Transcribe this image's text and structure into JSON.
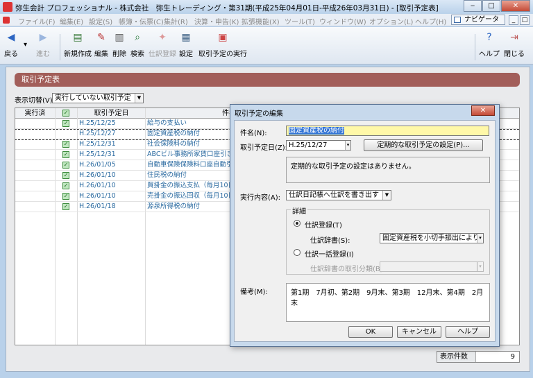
{
  "window": {
    "title": "弥生会計 プロフェッショナル - 株式会社　弥生トレーディング・第31期(平成25年04月01日-平成26年03月31日) - [取引予定表]"
  },
  "menu": [
    "ファイル(F)",
    "編集(E)",
    "設定(S)",
    "帳簿・伝票(C)",
    "集計(R)",
    "決算・申告(K)",
    "拡張機能(X)",
    "ツール(T)",
    "ウィンドウ(W)",
    "オプション(L)",
    "ヘルプ(H)"
  ],
  "navigator": "ナビゲータ",
  "toolbar": {
    "back": "戻る",
    "forward": "進む",
    "new": "新規作成",
    "edit": "編集",
    "delete": "削除",
    "search": "検索",
    "register": "仕訳登録",
    "settings": "設定",
    "execute": "取引予定の実行",
    "help": "ヘルプ",
    "close": "閉じる"
  },
  "panel": {
    "header": "取引予定表",
    "switch_label": "表示切替(V):",
    "switch_value": "実行していない取引予定",
    "columns": {
      "executed": "実行済",
      "date": "取引予定日",
      "name": "件名"
    },
    "rows": [
      {
        "checked": true,
        "date": "H.25/12/25",
        "name": "給与の支払い"
      },
      {
        "checked": false,
        "date": "H.25/12/27",
        "name": "固定資産税の納付"
      },
      {
        "checked": true,
        "date": "H.25/12/31",
        "name": "社会保険料の納付"
      },
      {
        "checked": true,
        "date": "H.25/12/31",
        "name": "ABCビル事務所家賃口座引き落"
      },
      {
        "checked": true,
        "date": "H.26/01/05",
        "name": "自動車保険保険料口座自動引"
      },
      {
        "checked": true,
        "date": "H.26/01/10",
        "name": "住民税の納付"
      },
      {
        "checked": true,
        "date": "H.26/01/10",
        "name": "買掛金の振込支払（毎月10日"
      },
      {
        "checked": true,
        "date": "H.26/01/10",
        "name": "売掛金の振込回収（毎月10日"
      },
      {
        "checked": true,
        "date": "H.26/01/18",
        "name": "源泉所得税の納付"
      }
    ],
    "count_label": "表示件数",
    "count_value": "9"
  },
  "dialog": {
    "title": "取引予定の編集",
    "subject_label": "件名(N):",
    "subject_value": "固定資産税の納付",
    "date_label": "取引予定日(Z):",
    "date_value": "H.25/12/27",
    "periodic_button": "定期的な取引予定の設定(P)...",
    "periodic_message": "定期的な取引予定の設定はありません。",
    "action_label": "実行内容(A):",
    "action_value": "仕訳日記帳へ仕訳を書き出す",
    "detail_group": "詳細",
    "radio_single": "仕訳登録(T)",
    "dict_label": "仕訳辞書(S):",
    "dict_value": "固定資産税を小切手振出により納付",
    "radio_batch": "仕訳一括登録(I)",
    "batch_label": "仕訳辞書の取引分類(B):",
    "memo_label": "備考(M):",
    "memo_value": "第1期　7月初、第2期　9月末、第3期　12月末、第4期　2月末",
    "ok": "OK",
    "cancel": "キャンセル",
    "help": "ヘルプ"
  }
}
